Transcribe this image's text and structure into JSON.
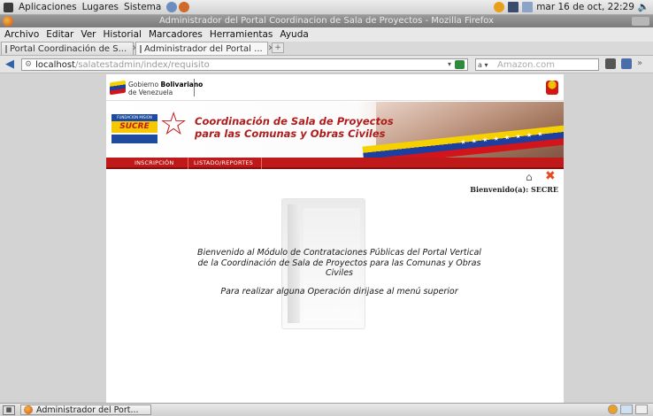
{
  "top_panel": {
    "menus": [
      "Aplicaciones",
      "Lugares",
      "Sistema"
    ],
    "datetime": "mar 16 de oct, 22:29"
  },
  "window": {
    "title": "Administrador del Portal Coordinacion de Sala de Proyectos - Mozilla Firefox"
  },
  "menubar": [
    "Archivo",
    "Editar",
    "Ver",
    "Historial",
    "Marcadores",
    "Herramientas",
    "Ayuda"
  ],
  "tabs": [
    {
      "label": "Portal Coordinación de S...",
      "close": "✕"
    },
    {
      "label": "Administrador del Portal ...",
      "close": "✕"
    }
  ],
  "navbar": {
    "url_host": "localhost",
    "url_path": "/salatestadmin/index/requisito",
    "search_placeholder": "Amazon.com",
    "search_engine": "a ▾"
  },
  "page": {
    "gov_header": {
      "line1": "Gobierno",
      "line1_bold": "Bolivariano",
      "line2": "de Venezuela"
    },
    "banner": {
      "title_line1": "Coordinación de Sala de Proyectos",
      "title_line2": "para las Comunas y Obras Civiles",
      "sucre_top": "FUNDACION MISION",
      "sucre_name": "SUCRE",
      "stars": "★ ★ ★ ★ ★ ★ ★ ★"
    },
    "menu": {
      "item1": "INSCRIPCIÓN",
      "item2": "LISTADO/REPORTES"
    },
    "welcome": "Bienvenido(a):  SECRE",
    "intro": "Bienvenido al Módulo de Contrataciones Públicas del Portal Vertical de la Coordinación de Sala de Proyectos para las Comunas y Obras Civiles",
    "instruction": "Para realizar alguna Operación dirijase al menú superior"
  },
  "taskbar": {
    "window_label": "Administrador del Port..."
  },
  "colors": {
    "menu_red": "#c01919",
    "title_red": "#b01c1c",
    "flag_yellow": "#f6d100",
    "flag_blue": "#1f3fa0",
    "flag_red": "#d1151a"
  }
}
